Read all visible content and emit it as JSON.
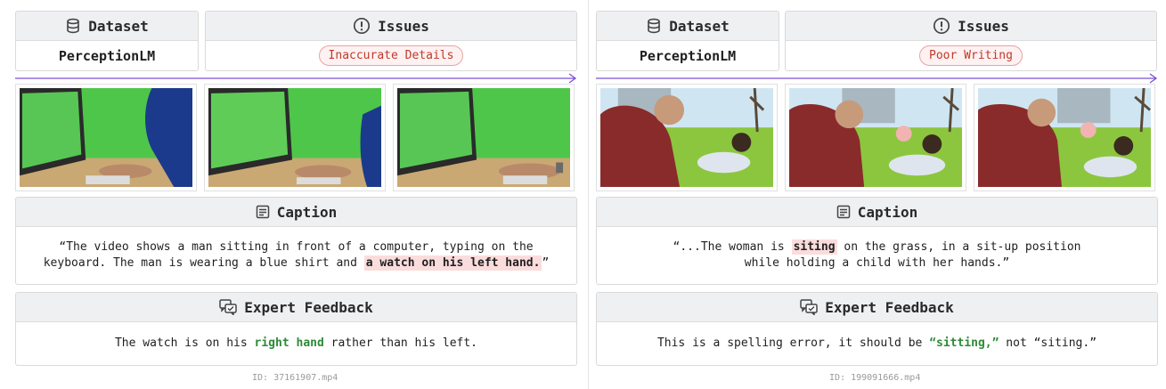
{
  "left": {
    "dataset_label": "Dataset",
    "dataset_value": "PerceptionLM",
    "issues_label": "Issues",
    "issue_value": "Inaccurate Details",
    "caption_label": "Caption",
    "caption_part1": "“The video shows a man sitting in front of a computer, typing on the",
    "caption_part2": "keyboard. The man is wearing a blue shirt and ",
    "caption_highlight": "a watch on his left hand.",
    "caption_end": "”",
    "feedback_label": "Expert Feedback",
    "feedback_part1": "The watch is on his ",
    "feedback_highlight": "right hand",
    "feedback_part2": " rather than his left.",
    "id_text": "ID: 37161907.mp4"
  },
  "right": {
    "dataset_label": "Dataset",
    "dataset_value": "PerceptionLM",
    "issues_label": "Issues",
    "issue_value": "Poor Writing",
    "caption_label": "Caption",
    "caption_part1": "“...The woman is ",
    "caption_highlight": "siting",
    "caption_part2": " on the grass, in a sit-up position",
    "caption_line2": "while holding a child with her hands.”",
    "feedback_label": "Expert Feedback",
    "feedback_part1": "This is a spelling error, it should be ",
    "feedback_highlight": "“sitting,”",
    "feedback_part2": " not “siting.”",
    "id_text": "ID: 199091666.mp4"
  },
  "colors": {
    "issue_red": "#c0392b",
    "correction_green": "#2e8b37",
    "arrow_purple": "#7b4fd6",
    "header_bg": "#eef0f2"
  },
  "icons": [
    "database-icon",
    "alert-circle-icon",
    "caption-icon",
    "feedback-chat-icon"
  ]
}
